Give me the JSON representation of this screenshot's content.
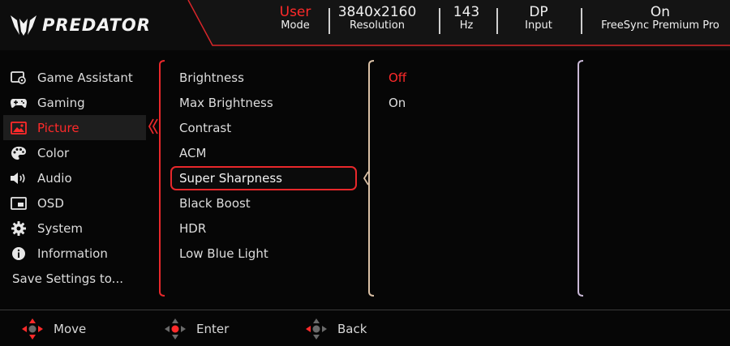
{
  "header": {
    "brand": "PREDATOR",
    "stats": [
      {
        "value": "User",
        "label": "Mode"
      },
      {
        "value": "3840x2160",
        "label": "Resolution"
      },
      {
        "value": "143",
        "label": "Hz"
      },
      {
        "value": "DP",
        "label": "Input"
      },
      {
        "value": "On",
        "label": "FreeSync Premium Pro"
      }
    ]
  },
  "menu": {
    "items": [
      {
        "label": "Game Assistant",
        "icon": "game-assistant-icon"
      },
      {
        "label": "Gaming",
        "icon": "gamepad-icon"
      },
      {
        "label": "Picture",
        "icon": "picture-icon",
        "selected": true
      },
      {
        "label": "Color",
        "icon": "palette-icon"
      },
      {
        "label": "Audio",
        "icon": "speaker-icon"
      },
      {
        "label": "OSD",
        "icon": "osd-icon"
      },
      {
        "label": "System",
        "icon": "gear-icon"
      },
      {
        "label": "Information",
        "icon": "info-icon"
      }
    ],
    "save_label": "Save Settings to..."
  },
  "submenu": {
    "items": [
      {
        "label": "Brightness"
      },
      {
        "label": "Max Brightness"
      },
      {
        "label": "Contrast"
      },
      {
        "label": "ACM"
      },
      {
        "label": "Super Sharpness",
        "highlighted": true
      },
      {
        "label": "Black Boost"
      },
      {
        "label": "HDR"
      },
      {
        "label": "Low Blue Light"
      }
    ]
  },
  "options": {
    "items": [
      {
        "label": "Off",
        "active": true
      },
      {
        "label": "On"
      }
    ]
  },
  "footer": {
    "hints": [
      {
        "label": "Move",
        "icon": "dpad-move-icon"
      },
      {
        "label": "Enter",
        "icon": "dpad-enter-icon"
      },
      {
        "label": "Back",
        "icon": "dpad-back-icon"
      }
    ]
  },
  "colors": {
    "accent": "#ff2a2a",
    "background": "#060606",
    "header_panel": "#151515"
  }
}
